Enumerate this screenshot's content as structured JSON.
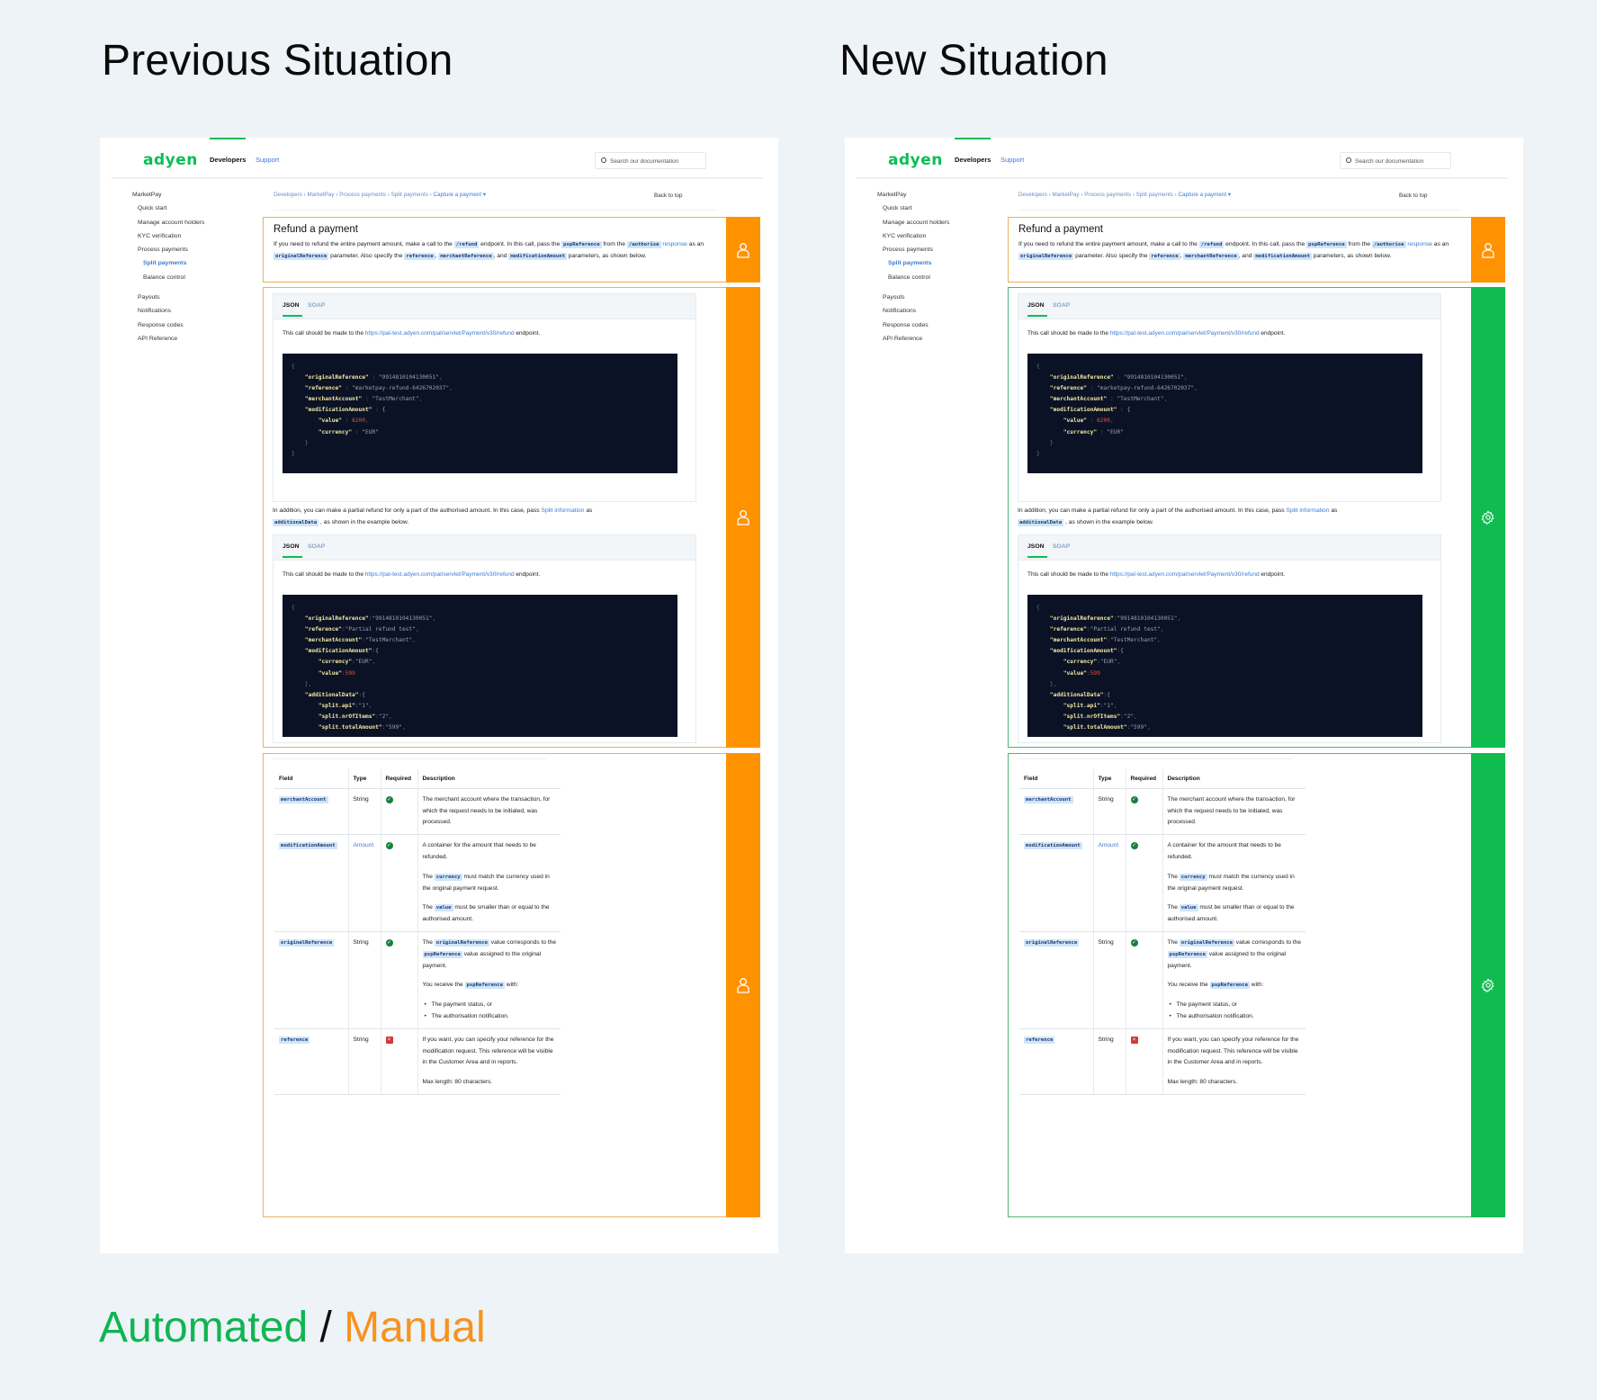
{
  "titles": {
    "previous": "Previous Situation",
    "new": "New Situation"
  },
  "legend": {
    "automated": "Automated",
    "separator": " / ",
    "manual": "Manual",
    "automated_color": "#10b551",
    "manual_color": "#f7931e"
  },
  "colors": {
    "manual_strip": "#ff9200",
    "automated_strip": "#10bc4f",
    "brand": "#0abf53",
    "link": "#3a7bd5"
  },
  "site": {
    "logo": "adyen",
    "nav": {
      "developers": "Developers",
      "support": "Support"
    },
    "search_placeholder": "Search our documentation",
    "sidebar": [
      {
        "label": "MarketPay",
        "level": 0
      },
      {
        "label": "Quick start",
        "level": 1
      },
      {
        "label": "Manage account holders",
        "level": 1
      },
      {
        "label": "KYC verification",
        "level": 1
      },
      {
        "label": "Process payments",
        "level": 1
      },
      {
        "label": "Split payments",
        "level": 2,
        "active": true
      },
      {
        "label": "Balance control",
        "level": 2
      },
      {
        "label": "Payouts",
        "level": 1
      },
      {
        "label": "Notifications",
        "level": 1
      },
      {
        "label": "Response codes",
        "level": 1
      },
      {
        "label": "API Reference",
        "level": 1
      }
    ],
    "breadcrumb": [
      "Developers",
      "MarketPay",
      "Process payments",
      "Split payments",
      "Capture a payment"
    ],
    "breadcrumb_sep": "›",
    "back_to_top": "Back to top",
    "section1": {
      "heading": "Refund a payment",
      "t1": "If you need to refund the entire payment amount, make a call to the ",
      "c_refund": "/refund",
      "t2": " endpoint. In this call, pass the ",
      "c_psp": "pspReference",
      "t3": " from the ",
      "c_authorise": "/authorise",
      "l_response": "response",
      "t4": " as an ",
      "c_orig": "originalReference",
      "t5": " parameter. Also specify the ",
      "c_ref": "reference",
      "t6": ", ",
      "c_mref": "merchantReference",
      "t7": ", and ",
      "c_mod": "modificationAmount",
      "t8": " parameters, as shown below."
    },
    "section2": {
      "tab_json": "JSON",
      "tab_soap": "SOAP",
      "endpoint_pre": "This call should be made to the ",
      "endpoint_url": "https://pal-test.adyen.com/pal/servlet/Payment/v30/refund",
      "endpoint_post": " endpoint.",
      "code1": [
        {
          "k": "\"originalReference\"",
          "s": "\"9914810104130051\"",
          "indent": 1
        },
        {
          "k": "\"reference\"",
          "s": "\"marketpay-refund-6426702037\"",
          "indent": 1
        },
        {
          "k": "\"merchantAccount\"",
          "s": "\"TestMerchant\"",
          "indent": 1
        },
        {
          "k": "\"modificationAmount\"",
          "s": "{",
          "indent": 1
        },
        {
          "k": "\"value\"",
          "n": "6200",
          "indent": 2
        },
        {
          "k": "\"currency\"",
          "s": "\"EUR\"",
          "indent": 2
        }
      ],
      "partial_t1": "In addition, you can make a partial refund for only a part of the authorised amount. In this case, pass ",
      "partial_link": "Split information",
      "partial_t2": " as ",
      "partial_code": "additionalData",
      "partial_t3": " , as shown in the example below.",
      "code2": [
        {
          "k": "\"originalReference\"",
          "s": "\"9914810104130051\"",
          "indent": 1
        },
        {
          "k": "\"reference\"",
          "s": "\"Partial refund test\"",
          "indent": 1
        },
        {
          "k": "\"merchantAccount\"",
          "s": "\"TestMerchant\"",
          "indent": 1
        },
        {
          "k": "\"modificationAmount\"",
          "s": "{",
          "indent": 1
        },
        {
          "k": "\"currency\"",
          "s": "\"EUR\"",
          "indent": 2
        },
        {
          "k": "\"value\"",
          "n": "599",
          "indent": 2
        },
        {
          "k": "\"additionalData\"",
          "s": "{",
          "indent": 1
        },
        {
          "k": "\"split.api\"",
          "s": "\"1\"",
          "indent": 2
        },
        {
          "k": "\"split.nrOfItems\"",
          "s": "\"2\"",
          "indent": 2
        },
        {
          "k": "\"split.totalAmount\"",
          "s": "\"599\"",
          "indent": 2
        }
      ]
    },
    "section3": {
      "headers": [
        "Field",
        "Type",
        "Required",
        "Description"
      ],
      "rows": [
        {
          "field": "merchantAccount",
          "type": "String",
          "required": true,
          "desc": [
            "The merchant account where the transaction, for which the request needs to be initiated, was processed."
          ]
        },
        {
          "field": "modificationAmount",
          "type": "Amount",
          "type_link": true,
          "required": true,
          "desc": [
            "A container for the amount that needs to be refunded.",
            "The {currency} must match the currency used in the original payment request.",
            "The {value} must be smaller than or equal to the authorised amount."
          ]
        },
        {
          "field": "originalReference",
          "type": "String",
          "required": true,
          "desc": [
            "The {originalReference} value corresponds to the {pspReference} value assigned to the original payment.",
            "You receive the {pspReference} with:"
          ],
          "bullets": [
            "The payment status, or",
            "The authorisation notification."
          ]
        },
        {
          "field": "reference",
          "type": "String",
          "required": false,
          "desc": [
            "If you want, you can specify your reference for the modification request. This reference will be visible in the Customer Area and in reports.",
            "Max length: 80 characters."
          ]
        }
      ]
    }
  },
  "panels": [
    {
      "key": "previous",
      "sections": [
        "manual",
        "manual",
        "manual"
      ]
    },
    {
      "key": "new",
      "sections": [
        "manual",
        "automated",
        "automated"
      ]
    }
  ],
  "icons": {
    "manual": "person-icon",
    "automated": "gear-icon"
  }
}
